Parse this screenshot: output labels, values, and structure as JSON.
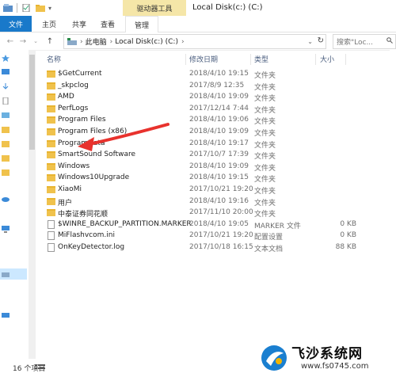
{
  "titlebar": {
    "context_tab": "驱动器工具",
    "window_title": "Local Disk(c:) (C:)"
  },
  "ribbon": {
    "tabs": [
      "文件",
      "主页",
      "共享",
      "查看",
      "管理"
    ]
  },
  "address": {
    "crumbs": [
      "此电脑",
      "Local Disk(c:) (C:)"
    ],
    "search_placeholder": "搜索\"Loc..."
  },
  "columns": {
    "name": "名称",
    "date": "修改日期",
    "type": "类型",
    "size": "大小"
  },
  "files": [
    {
      "name": "$GetCurrent",
      "date": "2018/4/10 19:15",
      "type": "文件夹",
      "size": "",
      "icon": "folder-icon"
    },
    {
      "name": "_skpclog",
      "date": "2017/8/9 12:35",
      "type": "文件夹",
      "size": "",
      "icon": "folder-icon"
    },
    {
      "name": "AMD",
      "date": "2018/4/10 19:09",
      "type": "文件夹",
      "size": "",
      "icon": "folder-icon"
    },
    {
      "name": "PerfLogs",
      "date": "2017/12/14 7:44",
      "type": "文件夹",
      "size": "",
      "icon": "folder-icon"
    },
    {
      "name": "Program Files",
      "date": "2018/4/10 19:06",
      "type": "文件夹",
      "size": "",
      "icon": "folder-icon"
    },
    {
      "name": "Program Files (x86)",
      "date": "2018/4/10 19:09",
      "type": "文件夹",
      "size": "",
      "icon": "folder-icon"
    },
    {
      "name": "ProgramData",
      "date": "2018/4/10 19:17",
      "type": "文件夹",
      "size": "",
      "icon": "folder-icon"
    },
    {
      "name": "SmartSound Software",
      "date": "2017/10/7 17:39",
      "type": "文件夹",
      "size": "",
      "icon": "folder-icon"
    },
    {
      "name": "Windows",
      "date": "2018/4/10 19:09",
      "type": "文件夹",
      "size": "",
      "icon": "folder-icon"
    },
    {
      "name": "Windows10Upgrade",
      "date": "2018/4/10 19:15",
      "type": "文件夹",
      "size": "",
      "icon": "folder-icon"
    },
    {
      "name": "XiaoMi",
      "date": "2017/10/21 19:20",
      "type": "文件夹",
      "size": "",
      "icon": "folder-icon"
    },
    {
      "name": "用户",
      "date": "2018/4/10 19:16",
      "type": "文件夹",
      "size": "",
      "icon": "folder-icon"
    },
    {
      "name": "中泰证券同花顺",
      "date": "2017/11/10 20:00",
      "type": "文件夹",
      "size": "",
      "icon": "folder-icon"
    },
    {
      "name": "$WINRE_BACKUP_PARTITION.MARKER",
      "date": "2018/4/10 19:05",
      "type": "MARKER 文件",
      "size": "0 KB",
      "icon": "file-icon"
    },
    {
      "name": "MiFlashvcom.ini",
      "date": "2017/10/21 19:20",
      "type": "配置设置",
      "size": "0 KB",
      "icon": "file-icon"
    },
    {
      "name": "OnKeyDetector.log",
      "date": "2017/10/18 16:15",
      "type": "文本文档",
      "size": "88 KB",
      "icon": "file-icon"
    }
  ],
  "status": {
    "item_count": "16 个项目"
  },
  "watermark": {
    "title": "飞沙系统网",
    "url": "www.fs0745.com"
  },
  "colors": {
    "accent": "#1979ca",
    "context_tab": "#f5e6a8",
    "folder": "#f0c24c",
    "annotation_arrow": "#e8322d"
  }
}
